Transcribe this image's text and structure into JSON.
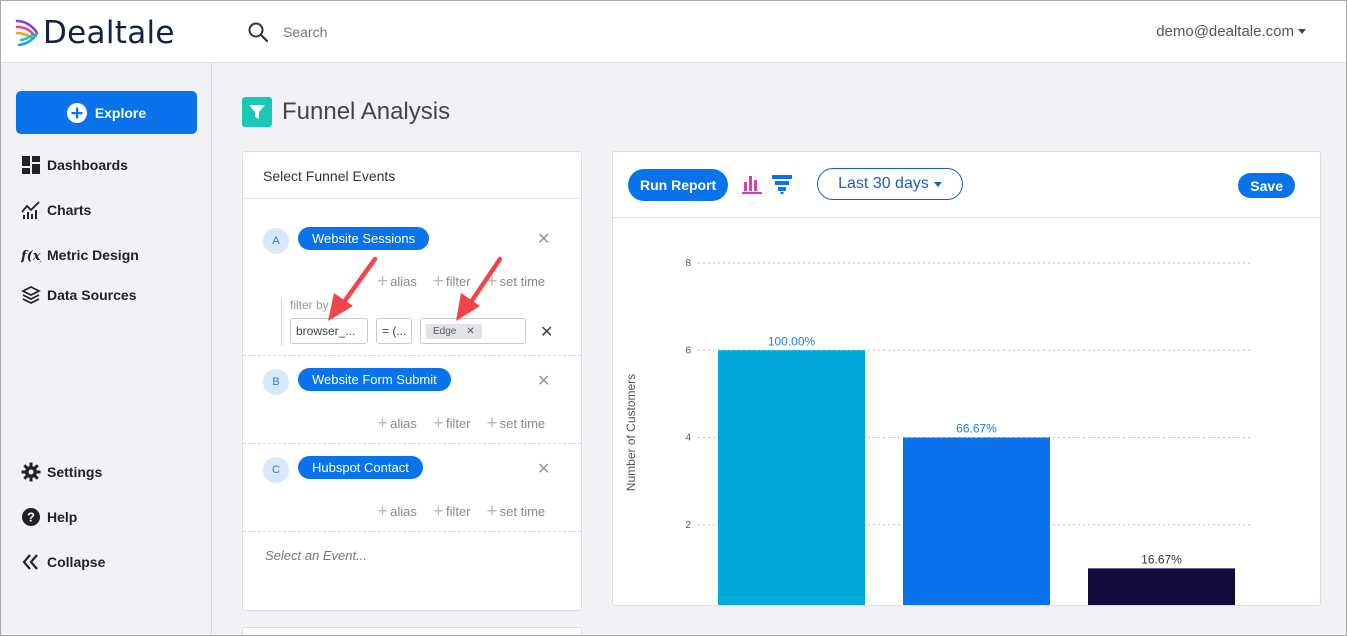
{
  "header": {
    "logo_text": "Dealtale",
    "search_placeholder": "Search",
    "user_email": "demo@dealtale.com"
  },
  "sidebar": {
    "explore_label": "Explore",
    "items": [
      {
        "label": "Dashboards",
        "icon": "dashboard-icon"
      },
      {
        "label": "Charts",
        "icon": "charts-icon"
      },
      {
        "label": "Metric Design",
        "icon": "function-icon"
      },
      {
        "label": "Data Sources",
        "icon": "layers-icon"
      }
    ],
    "bottom_items": [
      {
        "label": "Settings",
        "icon": "gear-icon"
      },
      {
        "label": "Help",
        "icon": "help-icon"
      },
      {
        "label": "Collapse",
        "icon": "collapse-icon"
      }
    ]
  },
  "page": {
    "title": "Funnel Analysis"
  },
  "events_panel": {
    "heading": "Select Funnel Events",
    "events": [
      {
        "letter": "A",
        "name": "Website Sessions"
      },
      {
        "letter": "B",
        "name": "Website Form Submit"
      },
      {
        "letter": "C",
        "name": "Hubspot Contact"
      }
    ],
    "options": {
      "alias": "alias",
      "filter": "filter",
      "set_time": "set time"
    },
    "filter": {
      "label": "filter by",
      "field": "browser_...",
      "operator": "= (...",
      "value": "Edge"
    },
    "select_placeholder": "Select an Event..."
  },
  "chart_toolbar": {
    "run_label": "Run Report",
    "range_label": "Last 30 days",
    "save_label": "Save"
  },
  "colors": {
    "primary": "#0a73eb",
    "arrow": "#f0454b",
    "bar1": "#00aadc",
    "bar2": "#0a73eb",
    "bar3": "#120c3d"
  },
  "chart_data": {
    "type": "bar",
    "categories": [
      "Website Sessions",
      "Website Form Submit",
      "Hubspot Contact"
    ],
    "values": [
      6,
      4,
      1
    ],
    "data_labels": [
      "100.00%",
      "66.67%",
      "16.67%"
    ],
    "ylabel": "Number of Customers",
    "xlabel": "",
    "ylim": [
      0,
      8
    ],
    "yticks": [
      0,
      2,
      4,
      6,
      8
    ],
    "grid": true,
    "bar_colors": [
      "#00aadc",
      "#0a73eb",
      "#120c3d"
    ]
  }
}
